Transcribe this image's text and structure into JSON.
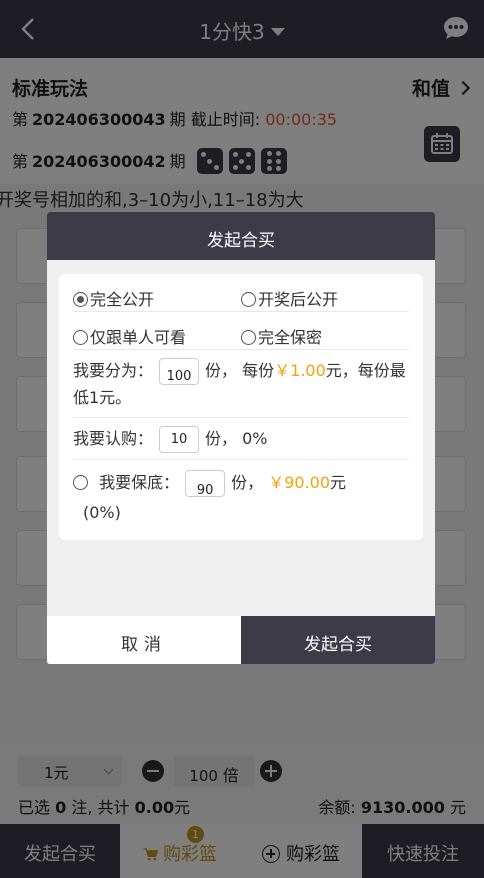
{
  "header": {
    "title": "1分快3"
  },
  "game": {
    "mode_name": "标准玩法",
    "mode_switch": "和值",
    "current": {
      "prefix": "第",
      "number": "202406300043",
      "suffix": "期",
      "deadline_label": "截止时间:",
      "deadline": "00:00:35"
    },
    "last": {
      "prefix": "第",
      "number": "202406300042",
      "suffix": "期",
      "dice": [
        3,
        5,
        6
      ]
    },
    "description": "开奖号相加的和,3–10为小,11–18为大"
  },
  "modal": {
    "title": "发起合买",
    "visibility_options": [
      {
        "label": "完全公开",
        "selected": true
      },
      {
        "label": "开奖后公开",
        "selected": false
      },
      {
        "label": "仅跟单人可看",
        "selected": false
      },
      {
        "label": "完全保密",
        "selected": false
      }
    ],
    "split": {
      "label": "我要分为：",
      "value": "100",
      "unit": "份，",
      "per_label": "每份",
      "per_price": "￥1.00",
      "per_unit": "元，",
      "min_text": "每份最低1元。"
    },
    "subscribe": {
      "label": "我要认购：",
      "value": "10",
      "unit": "份，",
      "percent": "0%"
    },
    "guarantee": {
      "label": "我要保底：",
      "value": "90",
      "unit": "份，",
      "amount": "￥90.00",
      "amount_unit": "元",
      "percent": "(0%)"
    },
    "cancel_label": "取消",
    "confirm_label": "发起合买"
  },
  "bet": {
    "unit": "1元",
    "multiple": "100",
    "multiple_unit": "倍",
    "selected_prefix": "已选",
    "selected_count": "0",
    "selected_mid": "注, 共计",
    "total": "0.00",
    "total_unit": "元",
    "balance_label": "余额:",
    "balance": "9130.000",
    "balance_unit": "元"
  },
  "bottom": {
    "start_group": "发起合买",
    "cart": "购彩篮",
    "cart_badge": "1",
    "add_cart": "购彩篮",
    "fast_bet": "快速投注"
  },
  "colors": {
    "header_bg": "#3c3b47",
    "accent_gold": "#f0a30a",
    "countdown": "#e25a2d"
  }
}
